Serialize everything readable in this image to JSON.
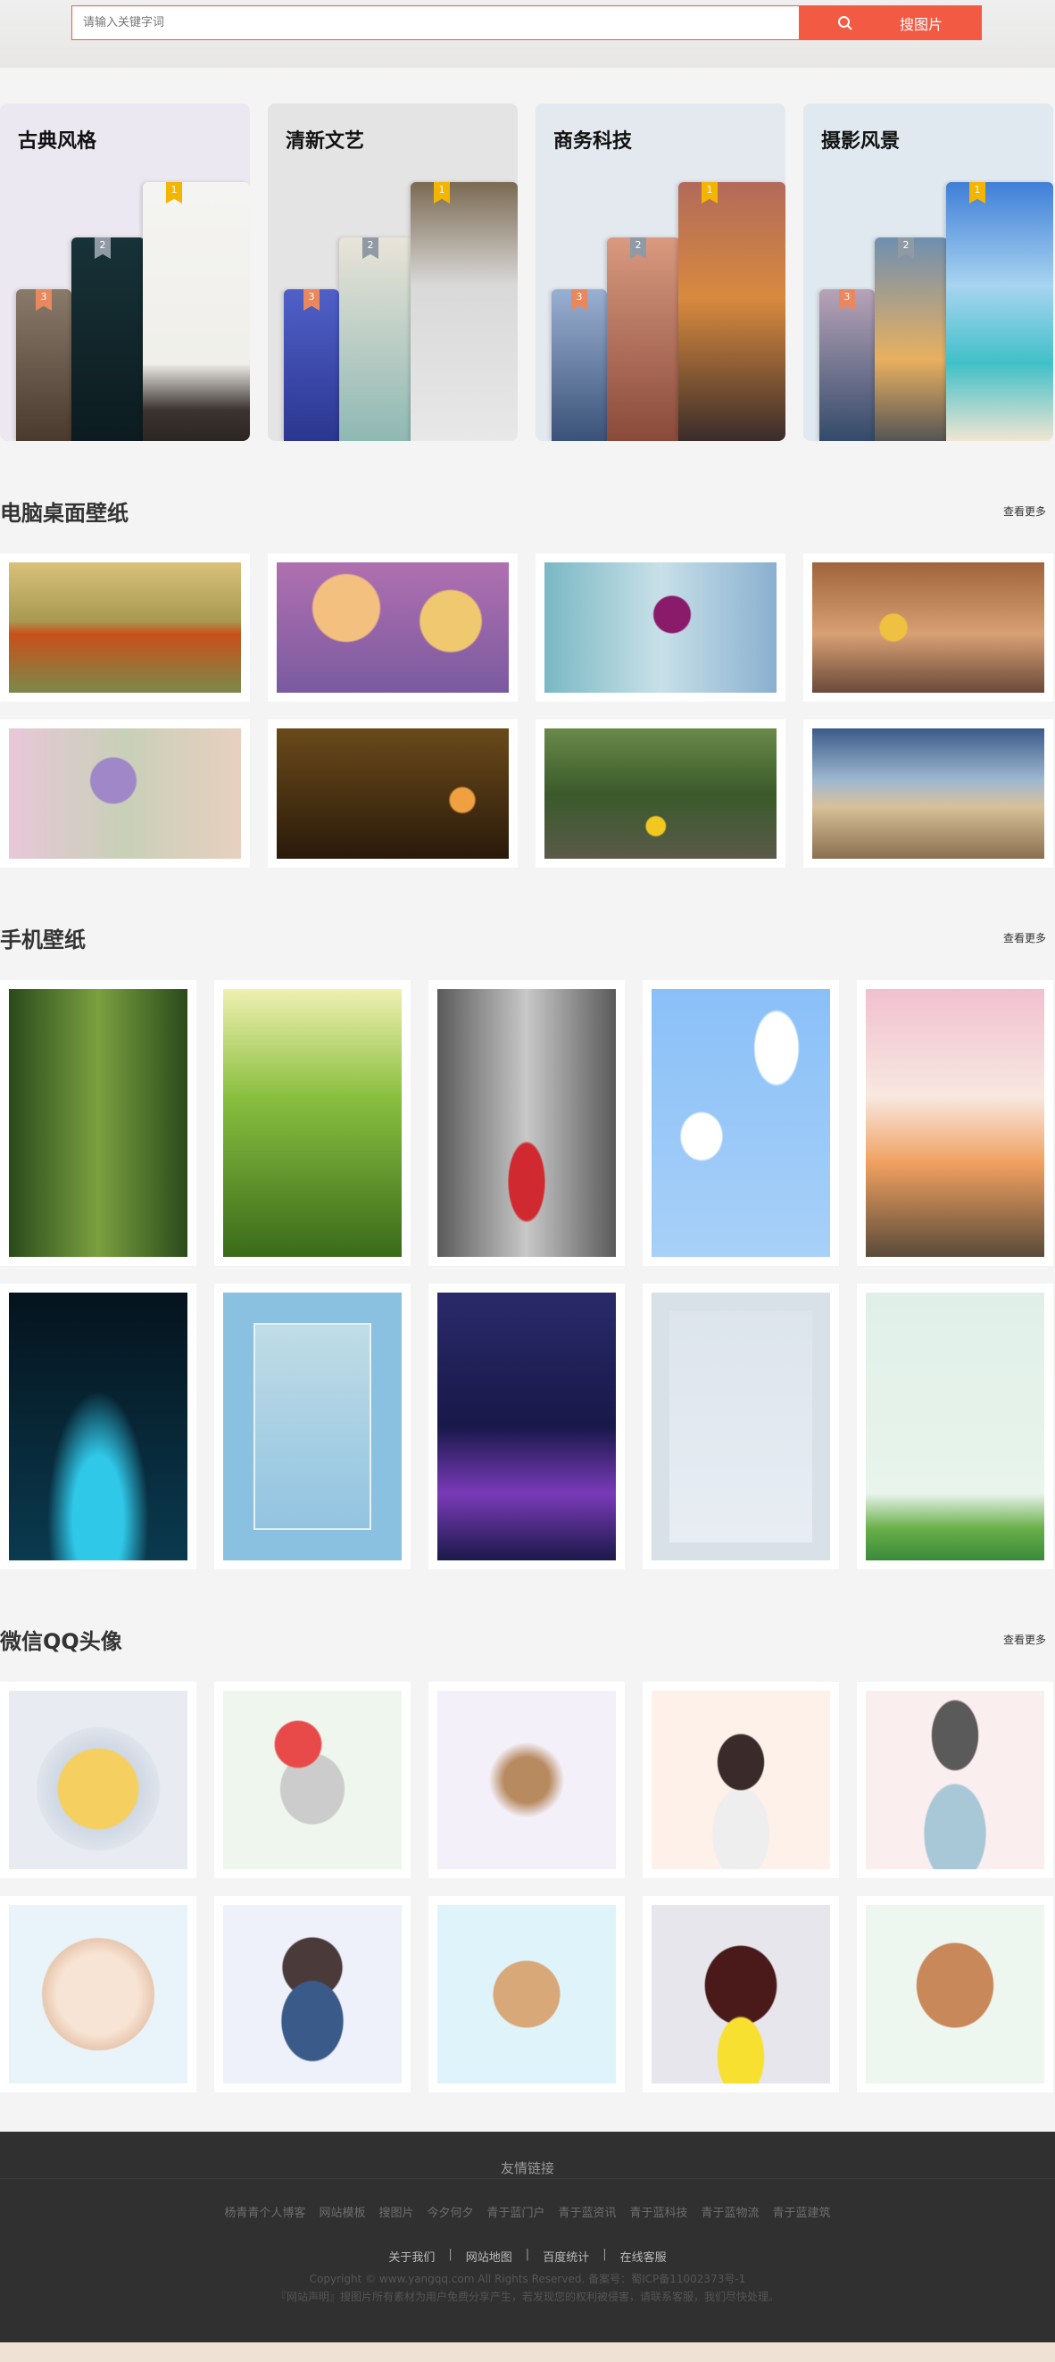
{
  "search": {
    "placeholder": "请输入关键字词",
    "button_label": "搜图片"
  },
  "categories": [
    {
      "title": "古典风格",
      "ranks": [
        "1",
        "2",
        "3"
      ],
      "bg": "#ece8f1"
    },
    {
      "title": "清新文艺",
      "ranks": [
        "1",
        "2",
        "3"
      ],
      "bg": "#e4e4e4"
    },
    {
      "title": "商务科技",
      "ranks": [
        "1",
        "2",
        "3"
      ],
      "bg": "#e4e8ef"
    },
    {
      "title": "摄影风景",
      "ranks": [
        "1",
        "2",
        "3"
      ],
      "bg": "#dfe9ef"
    }
  ],
  "sections": [
    {
      "title": "电脑桌面壁纸",
      "more": "查看更多"
    },
    {
      "title": "手机壁纸",
      "more": "查看更多"
    },
    {
      "title": "微信QQ头像",
      "more": "查看更多"
    }
  ],
  "footer": {
    "friend_links_title": "友情链接",
    "friend_links": [
      "杨青青个人博客",
      "网站模板",
      "搜图片",
      "今夕何夕",
      "青于蓝门户",
      "青于蓝资讯",
      "青于蓝科技",
      "青于蓝物流",
      "青于蓝建筑"
    ],
    "nav": [
      "关于我们",
      "网站地图",
      "百度统计",
      "在线客服"
    ],
    "nav_sep": "|",
    "copyright": "Copyright © www.yangqq.com All Rights Reserved. 备案号：蜀ICP备11002373号-1",
    "disclaimer": "『网站声明』搜图片所有素材为用户免费分享产生，若发现您的权利被侵害，请联系客服，我们尽快处理。"
  }
}
